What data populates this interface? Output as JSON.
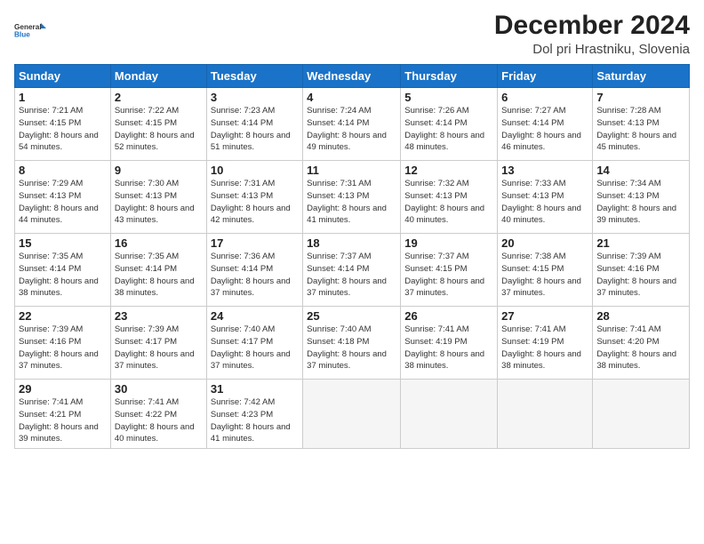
{
  "header": {
    "logo_line1": "General",
    "logo_line2": "Blue",
    "month": "December 2024",
    "location": "Dol pri Hrastniku, Slovenia"
  },
  "weekdays": [
    "Sunday",
    "Monday",
    "Tuesday",
    "Wednesday",
    "Thursday",
    "Friday",
    "Saturday"
  ],
  "weeks": [
    [
      {
        "day": "1",
        "sunrise": "Sunrise: 7:21 AM",
        "sunset": "Sunset: 4:15 PM",
        "daylight": "Daylight: 8 hours and 54 minutes."
      },
      {
        "day": "2",
        "sunrise": "Sunrise: 7:22 AM",
        "sunset": "Sunset: 4:15 PM",
        "daylight": "Daylight: 8 hours and 52 minutes."
      },
      {
        "day": "3",
        "sunrise": "Sunrise: 7:23 AM",
        "sunset": "Sunset: 4:14 PM",
        "daylight": "Daylight: 8 hours and 51 minutes."
      },
      {
        "day": "4",
        "sunrise": "Sunrise: 7:24 AM",
        "sunset": "Sunset: 4:14 PM",
        "daylight": "Daylight: 8 hours and 49 minutes."
      },
      {
        "day": "5",
        "sunrise": "Sunrise: 7:26 AM",
        "sunset": "Sunset: 4:14 PM",
        "daylight": "Daylight: 8 hours and 48 minutes."
      },
      {
        "day": "6",
        "sunrise": "Sunrise: 7:27 AM",
        "sunset": "Sunset: 4:14 PM",
        "daylight": "Daylight: 8 hours and 46 minutes."
      },
      {
        "day": "7",
        "sunrise": "Sunrise: 7:28 AM",
        "sunset": "Sunset: 4:13 PM",
        "daylight": "Daylight: 8 hours and 45 minutes."
      }
    ],
    [
      {
        "day": "8",
        "sunrise": "Sunrise: 7:29 AM",
        "sunset": "Sunset: 4:13 PM",
        "daylight": "Daylight: 8 hours and 44 minutes."
      },
      {
        "day": "9",
        "sunrise": "Sunrise: 7:30 AM",
        "sunset": "Sunset: 4:13 PM",
        "daylight": "Daylight: 8 hours and 43 minutes."
      },
      {
        "day": "10",
        "sunrise": "Sunrise: 7:31 AM",
        "sunset": "Sunset: 4:13 PM",
        "daylight": "Daylight: 8 hours and 42 minutes."
      },
      {
        "day": "11",
        "sunrise": "Sunrise: 7:31 AM",
        "sunset": "Sunset: 4:13 PM",
        "daylight": "Daylight: 8 hours and 41 minutes."
      },
      {
        "day": "12",
        "sunrise": "Sunrise: 7:32 AM",
        "sunset": "Sunset: 4:13 PM",
        "daylight": "Daylight: 8 hours and 40 minutes."
      },
      {
        "day": "13",
        "sunrise": "Sunrise: 7:33 AM",
        "sunset": "Sunset: 4:13 PM",
        "daylight": "Daylight: 8 hours and 40 minutes."
      },
      {
        "day": "14",
        "sunrise": "Sunrise: 7:34 AM",
        "sunset": "Sunset: 4:13 PM",
        "daylight": "Daylight: 8 hours and 39 minutes."
      }
    ],
    [
      {
        "day": "15",
        "sunrise": "Sunrise: 7:35 AM",
        "sunset": "Sunset: 4:14 PM",
        "daylight": "Daylight: 8 hours and 38 minutes."
      },
      {
        "day": "16",
        "sunrise": "Sunrise: 7:35 AM",
        "sunset": "Sunset: 4:14 PM",
        "daylight": "Daylight: 8 hours and 38 minutes."
      },
      {
        "day": "17",
        "sunrise": "Sunrise: 7:36 AM",
        "sunset": "Sunset: 4:14 PM",
        "daylight": "Daylight: 8 hours and 37 minutes."
      },
      {
        "day": "18",
        "sunrise": "Sunrise: 7:37 AM",
        "sunset": "Sunset: 4:14 PM",
        "daylight": "Daylight: 8 hours and 37 minutes."
      },
      {
        "day": "19",
        "sunrise": "Sunrise: 7:37 AM",
        "sunset": "Sunset: 4:15 PM",
        "daylight": "Daylight: 8 hours and 37 minutes."
      },
      {
        "day": "20",
        "sunrise": "Sunrise: 7:38 AM",
        "sunset": "Sunset: 4:15 PM",
        "daylight": "Daylight: 8 hours and 37 minutes."
      },
      {
        "day": "21",
        "sunrise": "Sunrise: 7:39 AM",
        "sunset": "Sunset: 4:16 PM",
        "daylight": "Daylight: 8 hours and 37 minutes."
      }
    ],
    [
      {
        "day": "22",
        "sunrise": "Sunrise: 7:39 AM",
        "sunset": "Sunset: 4:16 PM",
        "daylight": "Daylight: 8 hours and 37 minutes."
      },
      {
        "day": "23",
        "sunrise": "Sunrise: 7:39 AM",
        "sunset": "Sunset: 4:17 PM",
        "daylight": "Daylight: 8 hours and 37 minutes."
      },
      {
        "day": "24",
        "sunrise": "Sunrise: 7:40 AM",
        "sunset": "Sunset: 4:17 PM",
        "daylight": "Daylight: 8 hours and 37 minutes."
      },
      {
        "day": "25",
        "sunrise": "Sunrise: 7:40 AM",
        "sunset": "Sunset: 4:18 PM",
        "daylight": "Daylight: 8 hours and 37 minutes."
      },
      {
        "day": "26",
        "sunrise": "Sunrise: 7:41 AM",
        "sunset": "Sunset: 4:19 PM",
        "daylight": "Daylight: 8 hours and 38 minutes."
      },
      {
        "day": "27",
        "sunrise": "Sunrise: 7:41 AM",
        "sunset": "Sunset: 4:19 PM",
        "daylight": "Daylight: 8 hours and 38 minutes."
      },
      {
        "day": "28",
        "sunrise": "Sunrise: 7:41 AM",
        "sunset": "Sunset: 4:20 PM",
        "daylight": "Daylight: 8 hours and 38 minutes."
      }
    ],
    [
      {
        "day": "29",
        "sunrise": "Sunrise: 7:41 AM",
        "sunset": "Sunset: 4:21 PM",
        "daylight": "Daylight: 8 hours and 39 minutes."
      },
      {
        "day": "30",
        "sunrise": "Sunrise: 7:41 AM",
        "sunset": "Sunset: 4:22 PM",
        "daylight": "Daylight: 8 hours and 40 minutes."
      },
      {
        "day": "31",
        "sunrise": "Sunrise: 7:42 AM",
        "sunset": "Sunset: 4:23 PM",
        "daylight": "Daylight: 8 hours and 41 minutes."
      },
      null,
      null,
      null,
      null
    ]
  ]
}
